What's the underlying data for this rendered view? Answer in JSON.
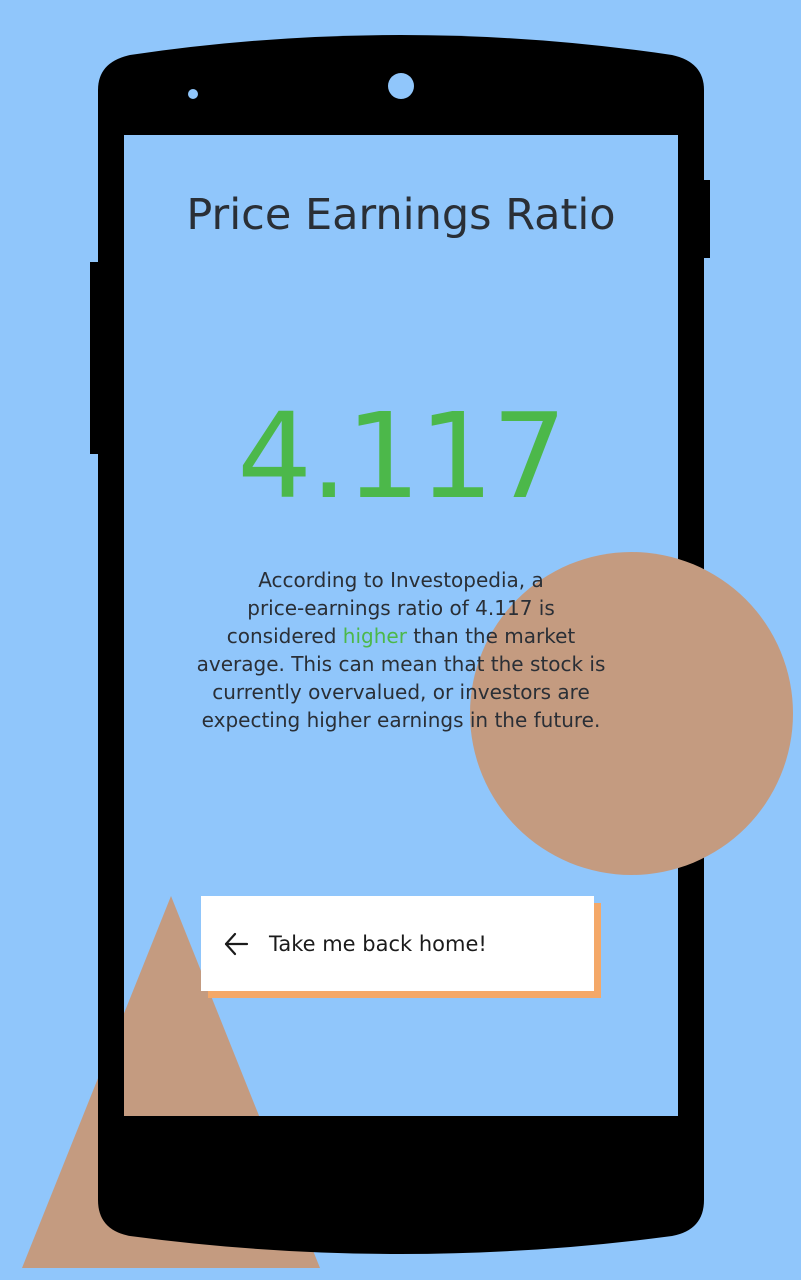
{
  "screen": {
    "title": "Price Earnings Ratio",
    "ratio_value": "4.117",
    "description": {
      "line1": "According to Investopedia, a",
      "line2": "price-earnings ratio of 4.117 is",
      "line3_pre": "considered ",
      "line3_highlight": "higher",
      "line3_post": " than the market",
      "line4": "average. This can mean that the stock is",
      "line5": "currently overvalued, or investors are",
      "line6": "expecting higher earnings in the future."
    },
    "home_button_label": "Take me back home!",
    "home_button_icon": "arrow-left-icon"
  },
  "colors": {
    "background": "#90c6fb",
    "accent_green": "#4cb84a",
    "shape_tan": "#c49b80",
    "button_shadow": "#f4a868",
    "phone_body": "#000000"
  }
}
